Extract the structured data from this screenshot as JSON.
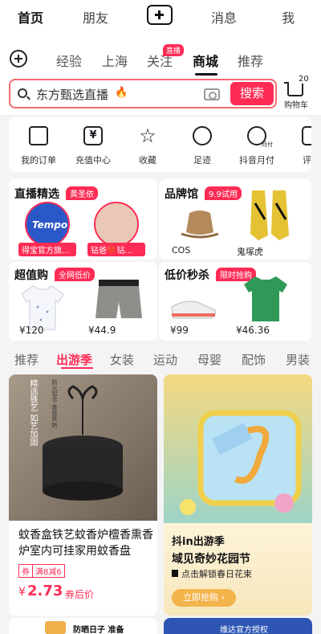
{
  "topnav": {
    "home": "首页",
    "friends": "朋友",
    "messages": "消息",
    "me": "我"
  },
  "subtabs": {
    "jingyan": "经验",
    "shanghai": "上海",
    "guanzhu": "关注",
    "live_badge": "直播",
    "mall": "商城",
    "recommend": "推荐"
  },
  "search": {
    "text": "东方甄选直播",
    "button": "搜索",
    "cart_count": "20",
    "cart_label": "购物车"
  },
  "quick": [
    "我的订单",
    "充值中心",
    "收藏",
    "足迹",
    "抖音月付",
    "评价"
  ],
  "quick_sub": "月付",
  "live_card": {
    "title": "直播精选",
    "tag": "黄圣依",
    "item1": "得宝官方旗...",
    "item2": "钻爸❤️钻...",
    "logo": "Tempo"
  },
  "brand_card": {
    "title": "品牌馆",
    "tag": "9.9试用",
    "b1": "COS",
    "b2": "鬼塚虎"
  },
  "value_card": {
    "title": "超值购",
    "tag": "全网低价",
    "p1": "¥120",
    "p2": "¥44.9"
  },
  "flash_card": {
    "title": "低价秒杀",
    "tag": "限时抢购",
    "p1": "¥99",
    "p2": "¥46.36"
  },
  "categories": [
    "推荐",
    "出游季",
    "女装",
    "运动",
    "母婴",
    "配饰",
    "男装"
  ],
  "feed1": {
    "title": "蚊香盒铁艺蚊香炉檀香熏香炉室内可挂家用蚊香盘",
    "coupon_prefix": "券",
    "coupon": "满8减6",
    "price_symbol": "¥",
    "price": "2.73",
    "price_note": "券后价",
    "vertical_text": "精选铁艺 如艺加固",
    "vertical_text2": "防火铝合 金底座 防"
  },
  "feed2": {
    "title1": "抖in出游季",
    "title2": "域见奇妙花园节",
    "sub": "点击解锁春日花束",
    "btn": "立即抢购 ›"
  },
  "bottom": {
    "badge_text": "防晒日子 准备",
    "right_text": "维达官方授权"
  },
  "colors": {
    "accent": "#fe2c55",
    "gold": "#f3b44c"
  }
}
